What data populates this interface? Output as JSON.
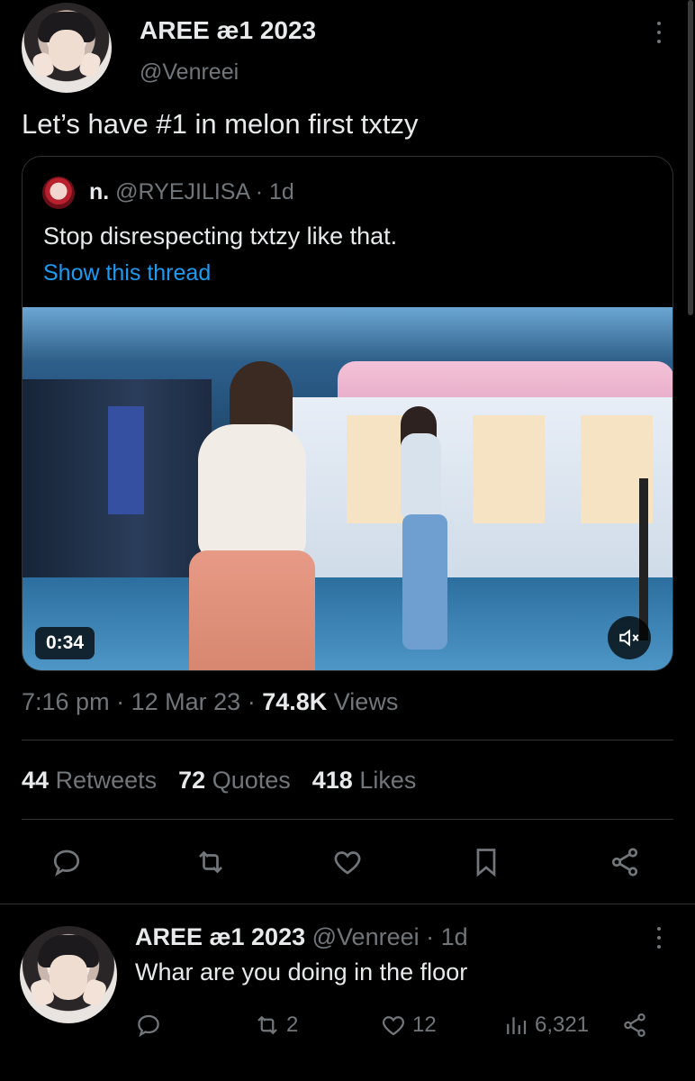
{
  "tweet": {
    "author_name": "AREE æ1 2023",
    "author_handle": "@Venreei",
    "text": "Let’s have #1 in melon first txtzy",
    "quote": {
      "name": "n.",
      "handle": "@RYEJILISA",
      "age": "· 1d",
      "text": "Stop disrespecting txtzy like that.",
      "thread_link": "Show this thread",
      "video_duration": "0:34"
    },
    "time": "7:16 pm",
    "date": "12 Mar 23",
    "sep": "·",
    "views_count": "74.8K",
    "views_label": "Views",
    "stats": {
      "retweets_count": "44",
      "retweets_label": "Retweets",
      "quotes_count": "72",
      "quotes_label": "Quotes",
      "likes_count": "418",
      "likes_label": "Likes"
    }
  },
  "reply": {
    "author_name": "AREE æ1 2023",
    "author_handle": "@Venreei",
    "age": "· 1d",
    "text": "Whar are you doing in the floor",
    "retweets": "2",
    "likes": "12",
    "views": "6,321"
  },
  "icons": [
    "more-icon",
    "reply-icon",
    "retweet-icon",
    "like-icon",
    "bookmark-icon",
    "share-icon",
    "views-icon",
    "mute-icon"
  ],
  "colors": {
    "background": "#000000",
    "text": "#e7e9ea",
    "muted": "#71767b",
    "link": "#1d9bf0",
    "border": "#2f3336"
  }
}
